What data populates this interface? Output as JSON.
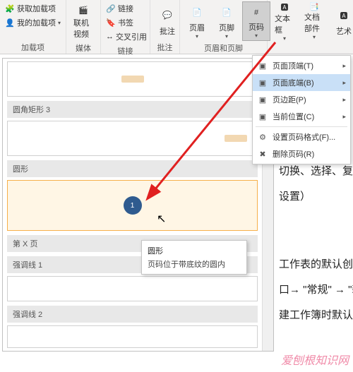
{
  "ribbon": {
    "groups": {
      "addins": {
        "label": "加载项",
        "get_addins": "获取加载项",
        "my_addins": "我的加载项"
      },
      "media": {
        "label": "媒体",
        "online_video": "联机视频"
      },
      "links": {
        "label": "链接",
        "link": "链接",
        "bookmark": "书签",
        "crossref": "交叉引用"
      },
      "comments": {
        "label": "批注",
        "comment": "批注"
      },
      "header_footer": {
        "label": "页眉和页脚",
        "header": "页眉",
        "footer": "页脚",
        "page_number": "页码"
      },
      "text": {
        "textbox": "文本框",
        "quickparts": "文档部件",
        "wordart": "艺术"
      }
    }
  },
  "dropdown": {
    "top": "页面顶端(T)",
    "bottom": "页面底端(B)",
    "margins": "页边距(P)",
    "current": "当前位置(C)",
    "format": "设置页码格式(F)...",
    "remove": "删除页码(R)"
  },
  "gallery": {
    "section_rounded_rect": "圆角矩形 3",
    "section_circle": "圆形",
    "circle_value": "1",
    "section_page_x": "第 X 页",
    "section_emphasis1": "强调线 1",
    "section_emphasis2": "强调线 2"
  },
  "tooltip": {
    "title": "圆形",
    "desc": "页码位于带底纹的圆内"
  },
  "doc": {
    "l1": "切换、选择、复",
    "l2": "设置）",
    "l3": "工作表的默认创建数",
    "l4": "口→ \"常规\" → \"新",
    "l5": "建工作簿时默认的工"
  },
  "watermark": "爱刨根知识网"
}
